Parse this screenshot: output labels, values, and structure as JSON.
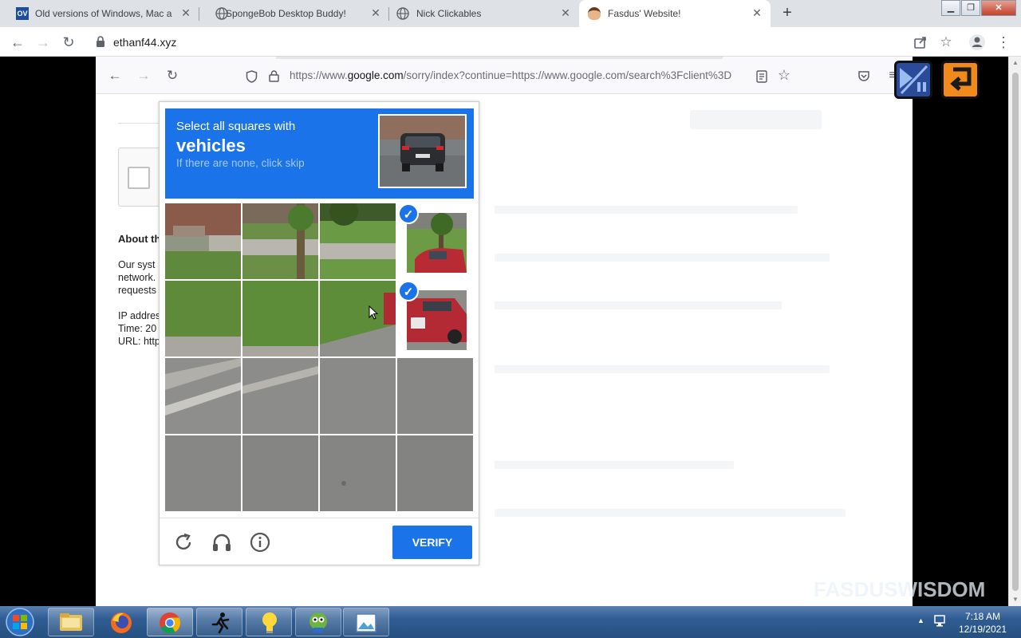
{
  "chrome": {
    "tabs": [
      {
        "title": "Old versions of Windows, Mac an",
        "favicon": "ov-favicon"
      },
      {
        "title": "SpongeBob Desktop Buddy!",
        "favicon": "globe-icon"
      },
      {
        "title": "Nick Clickables",
        "favicon": "globe-icon"
      },
      {
        "title": "Fasdus' Website!",
        "favicon": "fasdus-favicon"
      }
    ],
    "address": "ethanf44.xyz"
  },
  "inner_browser": {
    "url_prefix": "https://www.",
    "url_domain": "google.com",
    "url_rest": "/sorry/index?continue=https://www.google.com/search%3Fclient%3D"
  },
  "page": {
    "about_heading": "About th",
    "about_lines": [
      "Our syst",
      "network.",
      "requests"
    ],
    "info_lines": [
      "IP addres",
      "Time: 20",
      "URL: http"
    ]
  },
  "captcha": {
    "instruction": "Select all squares with",
    "target": "vehicles",
    "hint": "If there are none, click skip",
    "verify_label": "VERIFY",
    "selected_tiles": [
      3,
      7
    ],
    "grid": "4x4"
  },
  "watermark": "FASDUSWISDOM",
  "taskbar": {
    "time": "7:18 AM",
    "date": "12/19/2021"
  }
}
